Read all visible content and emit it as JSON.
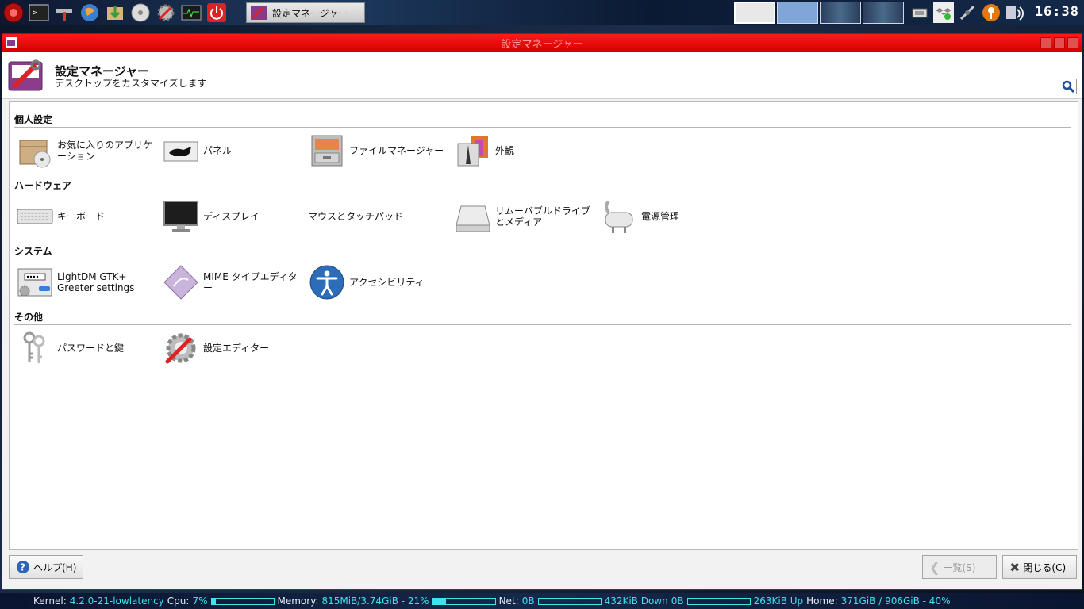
{
  "taskbar": {
    "task_title": "設定マネージャー",
    "clock": "16:38"
  },
  "window": {
    "title": "設定マネージャー",
    "header_title": "設定マネージャー",
    "header_subtitle": "デスクトップをカスタマイズします",
    "search_value": ""
  },
  "categories": [
    {
      "name": "個人設定",
      "items": [
        {
          "label": "お気に入りのアプリケーション",
          "icon": "preferred-apps-icon"
        },
        {
          "label": "パネル",
          "icon": "panel-icon"
        },
        {
          "label": "ファイルマネージャー",
          "icon": "file-manager-icon"
        },
        {
          "label": "外観",
          "icon": "appearance-icon"
        }
      ]
    },
    {
      "name": "ハードウェア",
      "items": [
        {
          "label": "キーボード",
          "icon": "keyboard-icon"
        },
        {
          "label": "ディスプレイ",
          "icon": "display-icon"
        },
        {
          "label": "マウスとタッチパッド",
          "icon": "mouse-icon"
        },
        {
          "label": "リムーバブルドライブとメディア",
          "icon": "removable-drive-icon"
        },
        {
          "label": "電源管理",
          "icon": "power-plug-icon"
        }
      ]
    },
    {
      "name": "システム",
      "items": [
        {
          "label": "LightDM GTK+ Greeter settings",
          "icon": "login-screen-icon"
        },
        {
          "label": "MIME タイプエディター",
          "icon": "mime-editor-icon"
        },
        {
          "label": "アクセシビリティ",
          "icon": "accessibility-icon"
        }
      ]
    },
    {
      "name": "その他",
      "items": [
        {
          "label": "パスワードと鍵",
          "icon": "keys-icon"
        },
        {
          "label": "設定エディター",
          "icon": "settings-editor-icon"
        }
      ]
    }
  ],
  "buttons": {
    "help": "ヘルプ(H)",
    "overview": "一覧(S)",
    "close": "閉じる(C)"
  },
  "conky": {
    "kernel_label": "Kernel:",
    "kernel": "4.2.0-21-lowlatency",
    "cpu_label": "Cpu:",
    "cpu": "7%",
    "mem_label": "Memory:",
    "mem": "815MiB/3.74GiB - 21%",
    "net_label": "Net:",
    "net": "0B",
    "down": "432KiB Down",
    "down_val": "0B",
    "up": "263KiB Up",
    "home_label": "Home:",
    "home": "371GiB / 906GiB - 40%",
    "cpu_fraction": 0.07,
    "mem_fraction": 0.21
  },
  "colors": {
    "titlebar": "#e00000",
    "conky_text": "#3fe2ee"
  }
}
